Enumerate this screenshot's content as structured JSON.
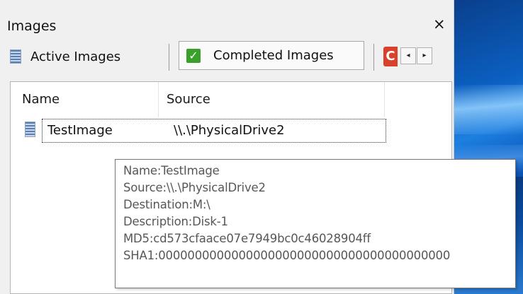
{
  "panel": {
    "title": "Images",
    "close_label": "×"
  },
  "tabs": [
    {
      "label": "Active Images",
      "icon": "image-list-icon",
      "selected": false
    },
    {
      "label": "Completed Images",
      "icon": "checkmark-icon",
      "selected": true
    }
  ],
  "tab_scroll": {
    "left_label": "◂",
    "right_label": "▸",
    "overflow_icon": "partial-tab-icon"
  },
  "table": {
    "columns": [
      "Name",
      "Source"
    ],
    "rows": [
      {
        "name": "TestImage",
        "source": "\\\\.\\PhysicalDrive2"
      }
    ]
  },
  "tooltip": {
    "lines": [
      "Name:TestImage",
      "Source:\\\\.\\PhysicalDrive2",
      "Destination:M:\\",
      "Description:Disk-1",
      "MD5:cd573cfaace07e7949bc0c46028904ff",
      "SHA1:0000000000000000000000000000000000000000"
    ]
  },
  "colors": {
    "accent_check": "#3aa02c",
    "overflow_tab": "#d8412a",
    "desktop_blue": "#0b5fc0"
  }
}
